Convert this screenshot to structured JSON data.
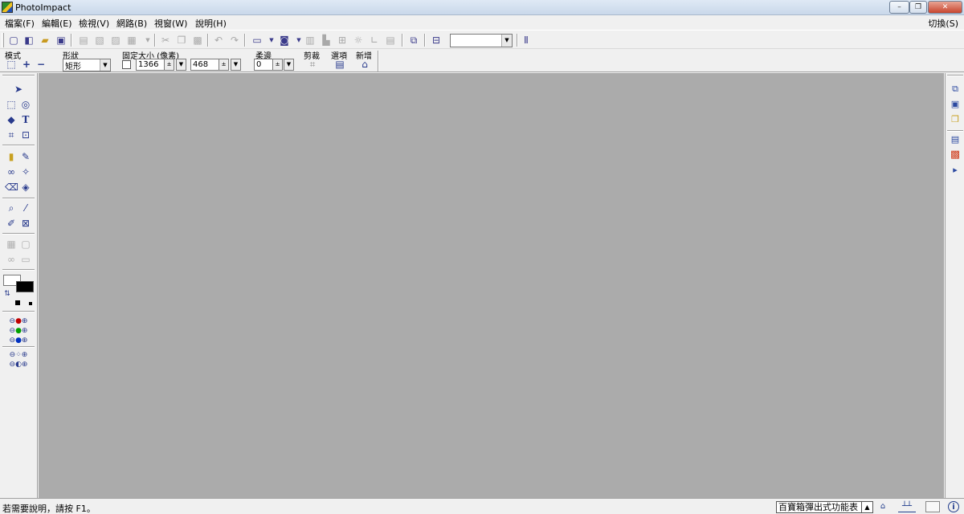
{
  "window": {
    "title": "PhotoImpact",
    "min_label": "–",
    "max_label": "❐",
    "close_label": "✕"
  },
  "menu": {
    "items": [
      {
        "label": "檔案(F)"
      },
      {
        "label": "編輯(E)"
      },
      {
        "label": "檢視(V)"
      },
      {
        "label": "網路(B)"
      },
      {
        "label": "視窗(W)"
      },
      {
        "label": "說明(H)"
      }
    ],
    "switch_label": "切換(S)"
  },
  "toolbar": {
    "icons": [
      "new-icon",
      "open-scan-icon",
      "open-icon",
      "save-icon",
      "print-icon",
      "print-preview-icon",
      "preview-icon",
      "send-icon",
      "cut-icon",
      "copy-icon",
      "paste-icon",
      "undo-icon",
      "redo-icon",
      "scanner-icon",
      "camera-icon",
      "zoom-fit-icon",
      "tool-a-icon",
      "tool-b-icon",
      "brightness-icon",
      "curve-icon",
      "doc-icon",
      "screen-icon",
      "layers-icon",
      "info-icon"
    ],
    "combo_value": ""
  },
  "attributes": {
    "mode_label": "模式",
    "shape_label": "形狀",
    "shape_value": "矩形",
    "fixed_size_label": "固定大小 (像素)",
    "fixed_size_checked": false,
    "width_value": "1366",
    "height_value": "468",
    "feather_label": "柔邊",
    "feather_value": "0",
    "crop_label": "剪裁",
    "options_label": "選項",
    "add_label": "新增"
  },
  "left_tools": [
    "pick-tool-icon",
    "selection-tool-icon",
    "lasso-tool-icon",
    "path-tool-icon",
    "text-tool-icon",
    "crop-tool-icon",
    "transform-tool-icon",
    "paint-tool-icon",
    "brush-tool-icon",
    "clone-tool-icon",
    "retouch-tool-icon",
    "eraser-tool-icon",
    "fill-tool-icon",
    "zoom-tool-icon",
    "eyedropper-tool-icon",
    "pen-tool-icon",
    "stamp-tool-icon",
    "grid-icon",
    "frame-icon",
    "link-icon",
    "ruler-icon"
  ],
  "colors": {
    "foreground": "#000000",
    "background": "#ffffff",
    "canvas": "#ababab",
    "swatch_red": "#c00000",
    "swatch_green": "#00a000",
    "swatch_blue": "#0030c0"
  },
  "right_tools": [
    "document-manager-icon",
    "layer-manager-icon",
    "stack-icon",
    "quick-command-icon",
    "palette-icon",
    "play-icon"
  ],
  "status": {
    "help_text": "若需要說明，請按 F1。",
    "mode_combo": "百寶箱彈出式功能表"
  }
}
